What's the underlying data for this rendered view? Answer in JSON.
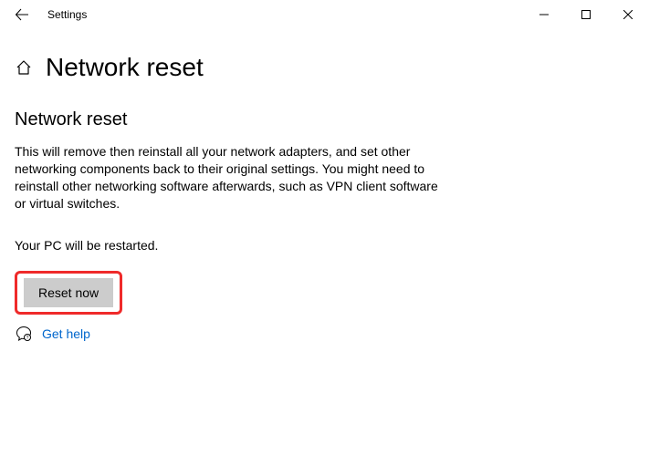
{
  "titlebar": {
    "label": "Settings"
  },
  "header": {
    "title": "Network reset"
  },
  "main": {
    "heading": "Network reset",
    "description": "This will remove then reinstall all your network adapters, and set other networking components back to their original settings. You might need to reinstall other networking software afterwards, such as VPN client software or virtual switches.",
    "restart_note": "Your PC will be restarted.",
    "reset_button": "Reset now"
  },
  "help": {
    "link_text": "Get help"
  }
}
